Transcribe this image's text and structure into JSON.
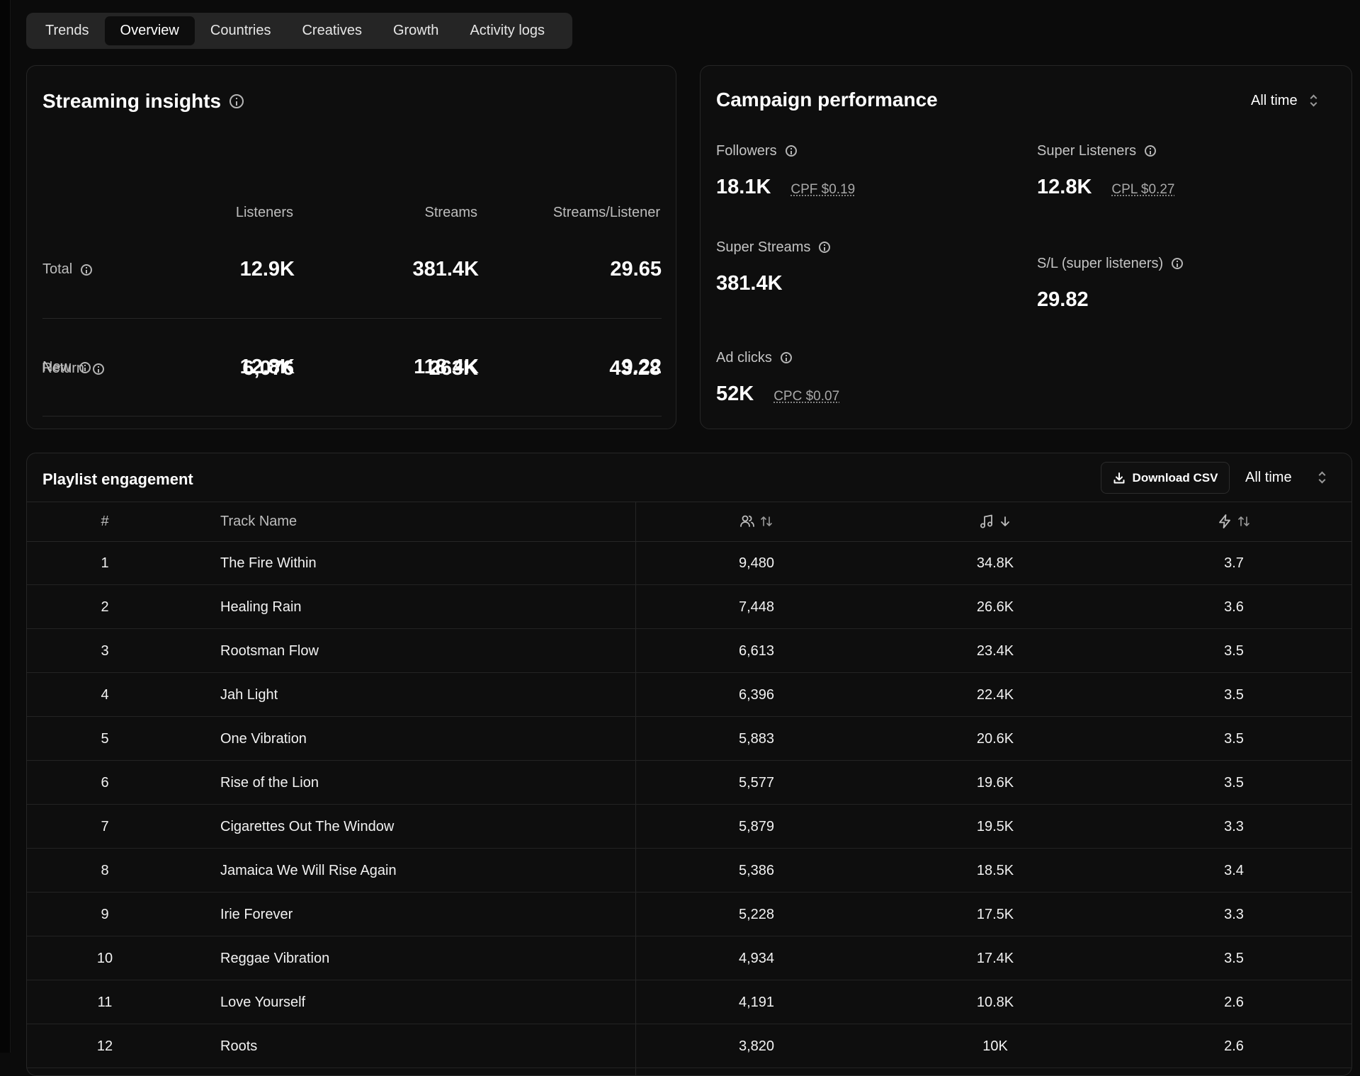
{
  "tabs": [
    {
      "label": "Trends",
      "active": false
    },
    {
      "label": "Overview",
      "active": true
    },
    {
      "label": "Countries",
      "active": false
    },
    {
      "label": "Creatives",
      "active": false
    },
    {
      "label": "Growth",
      "active": false
    },
    {
      "label": "Activity logs",
      "active": false
    }
  ],
  "streaming": {
    "title": "Streaming insights",
    "columns": [
      "Listeners",
      "Streams",
      "Streams/Listener"
    ],
    "rows": [
      {
        "label": "Total",
        "listeners": "12.9K",
        "streams": "381.4K",
        "ratio": "29.65"
      },
      {
        "label": "New",
        "listeners": "12.8K",
        "streams": "118.4K",
        "ratio": "9.22"
      },
      {
        "label": "Return",
        "listeners": "6,076",
        "streams": "263K",
        "ratio": "43.28"
      }
    ]
  },
  "campaign": {
    "title": "Campaign performance",
    "period": "All time",
    "metrics": [
      {
        "label": "Followers",
        "value": "18.1K",
        "sub": "CPF $0.19"
      },
      {
        "label": "Super Listeners",
        "value": "12.8K",
        "sub": "CPL $0.27"
      },
      {
        "label": "Super Streams",
        "value": "381.4K",
        "sub": ""
      },
      {
        "label": "S/L (super listeners)",
        "value": "29.82",
        "sub": ""
      },
      {
        "label": "Ad clicks",
        "value": "52K",
        "sub": "CPC $0.07"
      }
    ]
  },
  "playlist": {
    "title": "Playlist engagement",
    "download_label": "Download CSV",
    "period": "All time",
    "headers": {
      "num": "#",
      "track": "Track Name"
    },
    "header_icons": [
      "users-icon",
      "music-note-icon",
      "lightning-icon"
    ],
    "rows": [
      {
        "num": "1",
        "track": "The Fire Within",
        "listeners": "9,480",
        "streams": "34.8K",
        "ratio": "3.7"
      },
      {
        "num": "2",
        "track": "Healing Rain",
        "listeners": "7,448",
        "streams": "26.6K",
        "ratio": "3.6"
      },
      {
        "num": "3",
        "track": "Rootsman Flow",
        "listeners": "6,613",
        "streams": "23.4K",
        "ratio": "3.5"
      },
      {
        "num": "4",
        "track": "Jah Light",
        "listeners": "6,396",
        "streams": "22.4K",
        "ratio": "3.5"
      },
      {
        "num": "5",
        "track": "One Vibration",
        "listeners": "5,883",
        "streams": "20.6K",
        "ratio": "3.5"
      },
      {
        "num": "6",
        "track": "Rise of the Lion",
        "listeners": "5,577",
        "streams": "19.6K",
        "ratio": "3.5"
      },
      {
        "num": "7",
        "track": "Cigarettes Out The Window",
        "listeners": "5,879",
        "streams": "19.5K",
        "ratio": "3.3"
      },
      {
        "num": "8",
        "track": "Jamaica We Will Rise Again",
        "listeners": "5,386",
        "streams": "18.5K",
        "ratio": "3.4"
      },
      {
        "num": "9",
        "track": "Irie Forever",
        "listeners": "5,228",
        "streams": "17.5K",
        "ratio": "3.3"
      },
      {
        "num": "10",
        "track": "Reggae Vibration",
        "listeners": "4,934",
        "streams": "17.4K",
        "ratio": "3.5"
      },
      {
        "num": "11",
        "track": "Love Yourself",
        "listeners": "4,191",
        "streams": "10.8K",
        "ratio": "2.6"
      },
      {
        "num": "12",
        "track": "Roots",
        "listeners": "3,820",
        "streams": "10K",
        "ratio": "2.6"
      }
    ]
  }
}
